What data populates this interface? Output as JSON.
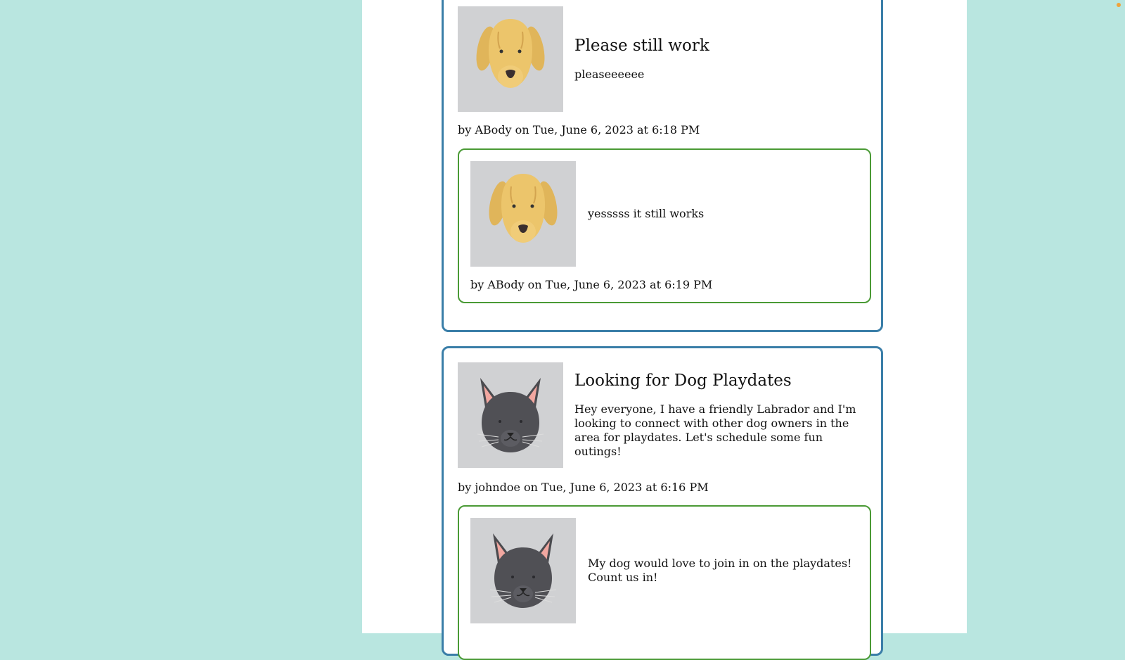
{
  "posts": [
    {
      "avatar": "dog-avatar",
      "title": "Please still work",
      "body": "pleaseeeeee",
      "meta": "by ABody on Tue, June 6, 2023 at 6:18 PM",
      "comments": [
        {
          "avatar": "dog-avatar",
          "body": "yesssss it still works",
          "meta": "by ABody on Tue, June 6, 2023 at 6:19 PM"
        }
      ]
    },
    {
      "avatar": "cat-avatar",
      "title": "Looking for Dog Playdates",
      "body": "Hey everyone, I have a friendly Labrador and I'm looking to connect with other dog owners in the area for playdates. Let's schedule some fun outings!",
      "meta": "by johndoe on Tue, June 6, 2023 at 6:16 PM",
      "comments": [
        {
          "avatar": "cat-avatar",
          "body": "My dog would love to join in on the playdates! Count us in!"
        }
      ]
    }
  ],
  "colors": {
    "background": "#b9e6e0",
    "post_border": "#3a7ea8",
    "comment_border": "#4a9a35",
    "avatar_bg": "#d0d1d3"
  }
}
